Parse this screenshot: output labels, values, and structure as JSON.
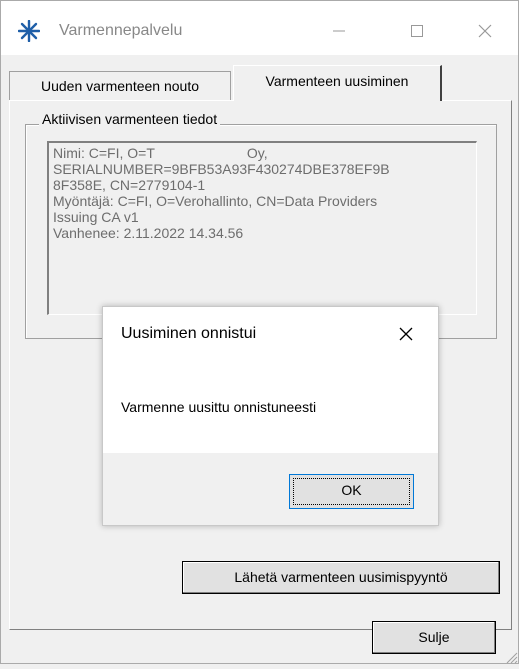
{
  "window": {
    "title": "Varmennepalvelu",
    "controls": {
      "minimize": "—",
      "maximize": "☐",
      "close": "✕"
    }
  },
  "tabs": [
    {
      "label": "Uuden varmenteen nouto",
      "active": false
    },
    {
      "label": "Varmenteen uusiminen",
      "active": true
    }
  ],
  "certificate_group": {
    "legend": "Aktiivisen varmenteen tiedot",
    "lines": [
      "Nimi: C=FI, O=T",
      "Oy,",
      "SERIALNUMBER=9BFB53A93F430274DBE378EF9B",
      "8F358E, CN=2779104-1",
      "Myöntäjä: C=FI, O=Verohallinto, CN=Data Providers",
      "Issuing CA v1",
      "Vanhenee: 2.11.2022 14.34.56"
    ]
  },
  "buttons": {
    "send_renewal": "Lähetä varmenteen uusimispyyntö",
    "close": "Sulje"
  },
  "dialog": {
    "title": "Uusiminen onnistui",
    "close_glyph": "✕",
    "message": "Varmenne uusittu onnistuneesti",
    "ok_label": "OK"
  },
  "colors": {
    "accent": "#1e5ea8",
    "focus_border": "#0078d7"
  }
}
